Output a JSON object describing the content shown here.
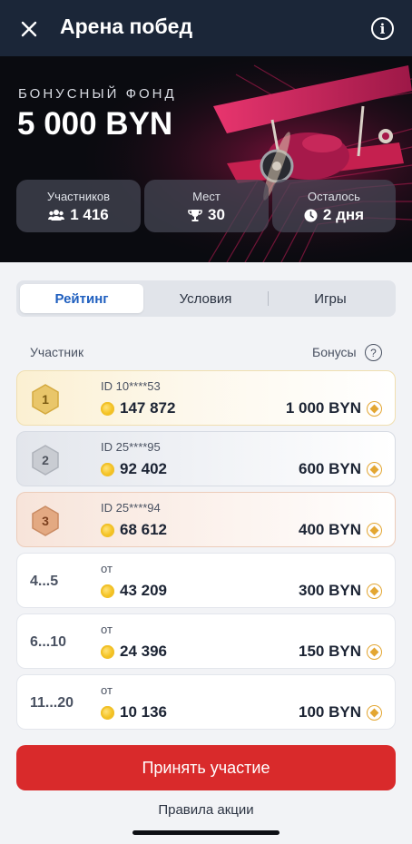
{
  "header": {
    "title": "Арена побед"
  },
  "hero": {
    "label": "БОНУСНЫЙ ФОНД",
    "amount": "5 000 BYN",
    "stats": [
      {
        "label": "Участников",
        "value": "1 416",
        "icon": "users-icon"
      },
      {
        "label": "Мест",
        "value": "30",
        "icon": "trophy-icon"
      },
      {
        "label": "Осталось",
        "value": "2 дня",
        "icon": "clock-icon"
      }
    ]
  },
  "tabs": [
    {
      "label": "Рейтинг",
      "active": true
    },
    {
      "label": "Условия",
      "active": false
    },
    {
      "label": "Игры",
      "active": false
    }
  ],
  "list": {
    "participant_header": "Участник",
    "bonus_header": "Бонусы",
    "help_glyph": "?",
    "rows": [
      {
        "place": "1",
        "sub": "ID 10****53",
        "score": "147 872",
        "prize": "1 000 BYN",
        "medal": "gold"
      },
      {
        "place": "2",
        "sub": "ID 25****95",
        "score": "92 402",
        "prize": "600 BYN",
        "medal": "silver"
      },
      {
        "place": "3",
        "sub": "ID 25****94",
        "score": "68 612",
        "prize": "400 BYN",
        "medal": "bronze"
      },
      {
        "place": "4...5",
        "sub": "от",
        "score": "43 209",
        "prize": "300 BYN"
      },
      {
        "place": "6...10",
        "sub": "от",
        "score": "24 396",
        "prize": "150 BYN"
      },
      {
        "place": "11...20",
        "sub": "от",
        "score": "10 136",
        "prize": "100 BYN"
      }
    ]
  },
  "actions": {
    "cta": "Принять участие",
    "rules": "Правила акции"
  },
  "colors": {
    "header_bg": "#1b2638",
    "accent_red": "#d92a2b",
    "tab_active": "#1f5fbf",
    "gold": "#e3a632"
  }
}
